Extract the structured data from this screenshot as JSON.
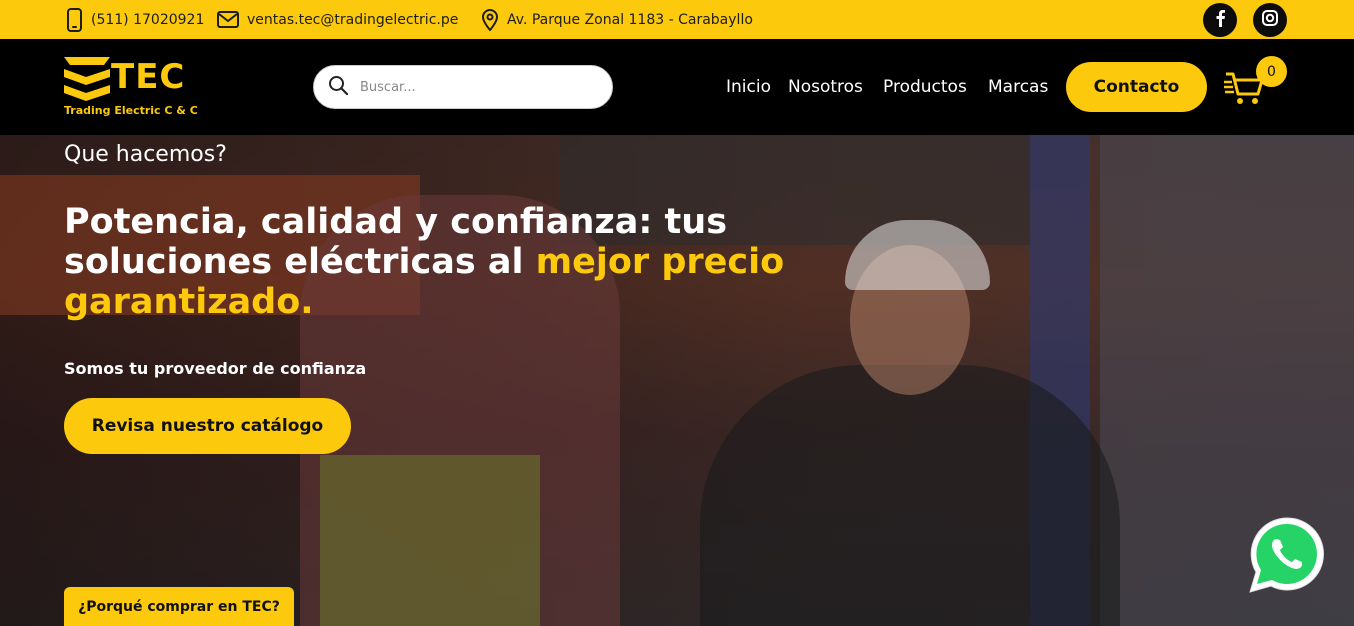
{
  "topbar": {
    "phone": "(511) 17020921",
    "email": "ventas.tec@tradingelectric.pe",
    "address": "Av. Parque Zonal 1183 - Carabayllo",
    "accent": "#fcc90c"
  },
  "logo": {
    "name": "TEC",
    "subtitle": "Trading Electric C & C"
  },
  "search": {
    "placeholder": "Buscar..."
  },
  "nav": {
    "items": [
      {
        "label": "Inicio"
      },
      {
        "label": "Nosotros"
      },
      {
        "label": "Productos"
      },
      {
        "label": "Marcas"
      }
    ],
    "contact_label": "Contacto",
    "cart_count": "0"
  },
  "hero": {
    "kicker": "Que hacemos?",
    "title_part1": "Potencia, calidad y confianza: tus soluciones eléctricas al ",
    "title_highlight": "mejor precio garantizado.",
    "subtitle": "Somos tu proveedor de confianza",
    "cta_label": "Revisa nuestro catálogo",
    "why_label": "¿Porqué comprar en TEC?"
  },
  "icons": [
    "phone-icon",
    "mail-icon",
    "location-icon",
    "facebook-icon",
    "instagram-icon",
    "search-icon",
    "cart-icon",
    "whatsapp-icon"
  ]
}
